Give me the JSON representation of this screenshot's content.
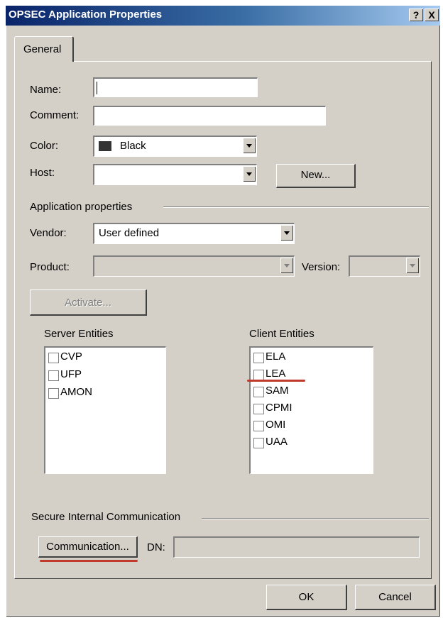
{
  "window": {
    "title": "OPSEC Application Properties",
    "help_label": "?",
    "close_label": "X"
  },
  "tabs": [
    {
      "label": "General"
    }
  ],
  "form": {
    "name_label": "Name:",
    "name_value": "",
    "comment_label": "Comment:",
    "comment_value": "",
    "color_label": "Color:",
    "color_value": "Black",
    "host_label": "Host:",
    "host_value": "",
    "new_button": "New..."
  },
  "app_props": {
    "heading": "Application properties",
    "vendor_label": "Vendor:",
    "vendor_value": "User defined",
    "product_label": "Product:",
    "product_value": "",
    "version_label": "Version:",
    "version_value": "",
    "activate_button": "Activate..."
  },
  "server_entities": {
    "label": "Server Entities",
    "items": [
      {
        "label": "CVP",
        "checked": false
      },
      {
        "label": "UFP",
        "checked": false
      },
      {
        "label": "AMON",
        "checked": false
      }
    ]
  },
  "client_entities": {
    "label": "Client Entities",
    "items": [
      {
        "label": "ELA",
        "checked": false
      },
      {
        "label": "LEA",
        "checked": false
      },
      {
        "label": "SAM",
        "checked": false
      },
      {
        "label": "CPMI",
        "checked": false
      },
      {
        "label": "OMI",
        "checked": false
      },
      {
        "label": "UAA",
        "checked": false
      }
    ]
  },
  "sic": {
    "heading": "Secure Internal Communication",
    "communication_button": "Communication...",
    "dn_label": "DN:",
    "dn_value": ""
  },
  "footer": {
    "ok_button": "OK",
    "cancel_button": "Cancel"
  },
  "colors": {
    "titlebar": "#0a246a",
    "face": "#d4d0c8",
    "annotation": "#c0392b"
  }
}
